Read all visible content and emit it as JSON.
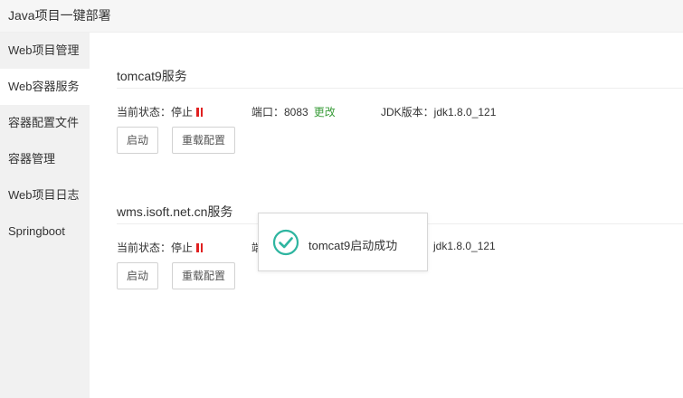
{
  "app": {
    "title": "Java项目一键部署"
  },
  "sidebar": {
    "items": [
      {
        "label": "Web项目管理"
      },
      {
        "label": "Web容器服务"
      },
      {
        "label": "容器配置文件"
      },
      {
        "label": "容器管理"
      },
      {
        "label": "Web项目日志"
      },
      {
        "label": "Springboot"
      }
    ]
  },
  "services": [
    {
      "title": "tomcat9服务",
      "status_label": "当前状态：停止",
      "port_label": "端口：8083",
      "change_label": "更改",
      "jdk_label": "JDK版本：jdk1.8.0_121",
      "start_label": "启动",
      "reload_label": "重载配置"
    },
    {
      "title": "wms.isoft.net.cn服务",
      "status_label": "当前状态：停止",
      "port_label": "端",
      "jdk_label": "jdk1.8.0_121",
      "start_label": "启动",
      "reload_label": "重载配置"
    }
  ],
  "toast": {
    "message": "tomcat9启动成功"
  },
  "colors": {
    "status_stop": "#e02020",
    "link_green": "#3a9c3a",
    "success_teal": "#2eb5a0"
  }
}
